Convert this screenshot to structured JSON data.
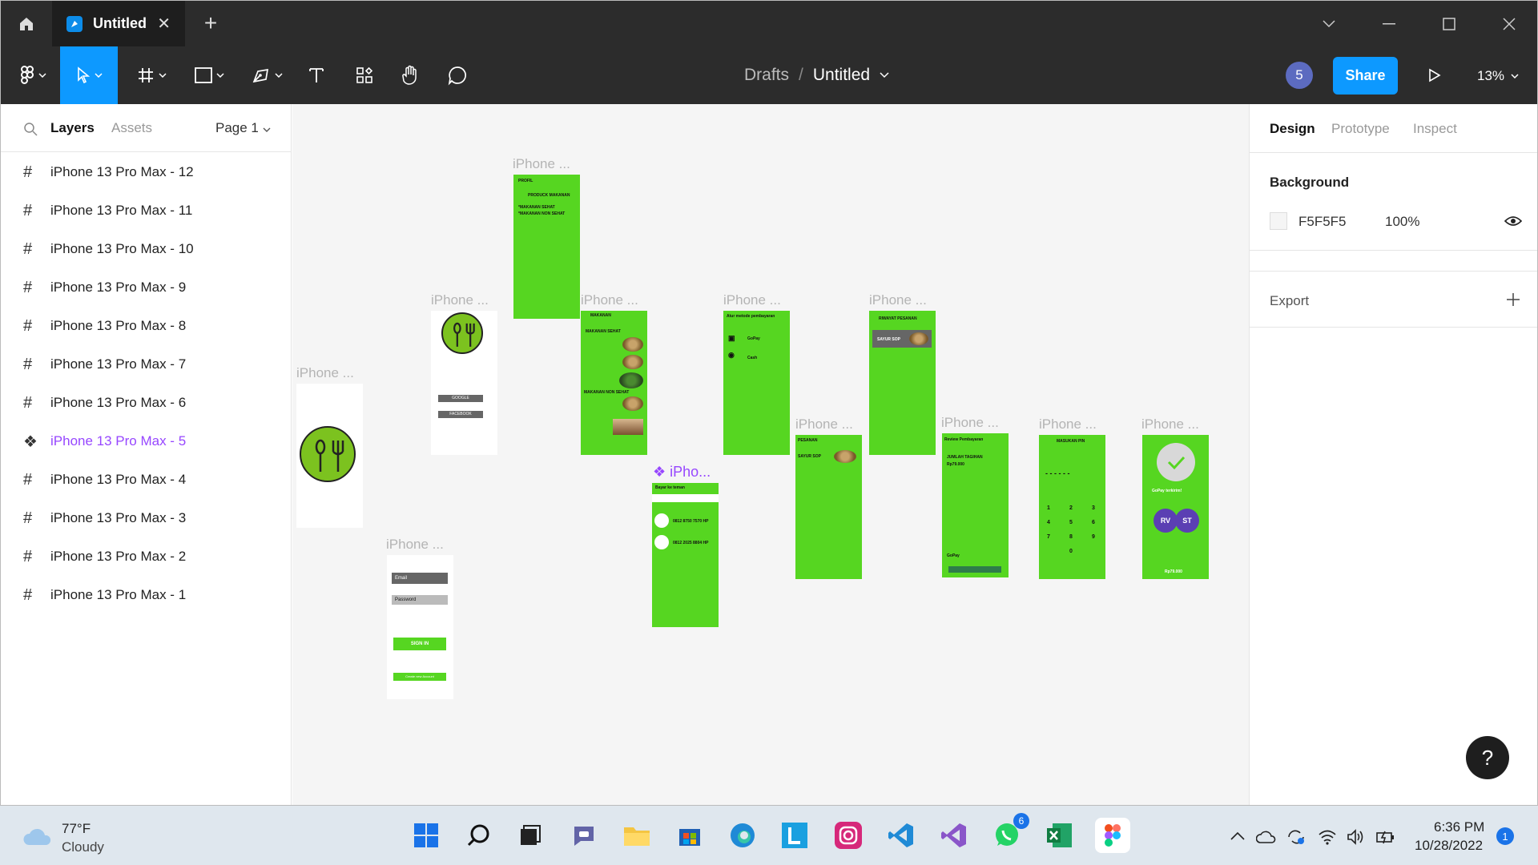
{
  "tab": {
    "title": "Untitled"
  },
  "breadcrumb": {
    "drafts": "Drafts",
    "sep": "/",
    "file": "Untitled"
  },
  "header": {
    "collab_count": "5",
    "share_label": "Share",
    "zoom": "13%"
  },
  "left_panel": {
    "tabs": {
      "layers": "Layers",
      "assets": "Assets"
    },
    "page": "Page 1",
    "layers": [
      {
        "name": "iPhone 13 Pro Max - 12",
        "type": "frame"
      },
      {
        "name": "iPhone 13 Pro Max - 11",
        "type": "frame"
      },
      {
        "name": "iPhone 13 Pro Max - 10",
        "type": "frame"
      },
      {
        "name": "iPhone 13 Pro Max - 9",
        "type": "frame"
      },
      {
        "name": "iPhone 13 Pro Max - 8",
        "type": "frame"
      },
      {
        "name": "iPhone 13 Pro Max - 7",
        "type": "frame"
      },
      {
        "name": "iPhone 13 Pro Max - 6",
        "type": "frame"
      },
      {
        "name": "iPhone 13 Pro Max - 5",
        "type": "component"
      },
      {
        "name": "iPhone 13 Pro Max - 4",
        "type": "frame"
      },
      {
        "name": "iPhone 13 Pro Max - 3",
        "type": "frame"
      },
      {
        "name": "iPhone 13 Pro Max - 2",
        "type": "frame"
      },
      {
        "name": "iPhone 13 Pro Max - 1",
        "type": "frame"
      }
    ]
  },
  "canvas": {
    "frame_label": "iPhone ...",
    "component_label": "iPho...",
    "screens": {
      "login_email": "Email",
      "login_password": "Password",
      "login_signin": "SIGN IN",
      "login_create": "Create new Account",
      "social_google": "GOOGLE",
      "social_facebook": "FACEBOOK",
      "profile_title": "PROFIL",
      "produk_title": "PRODUCK MAKANAN",
      "produk_line1": "*MAKANAN SEHAT",
      "produk_line2": "*MAKANAN NON SEHAT",
      "menu_heading": "MAKANAN",
      "menu_sehat": "MAKANAN SEHAT",
      "menu_nonsehat": "MAKANAN NON SEHAT",
      "pay_title": "Atur metode pembayaran",
      "pay_gopay": "GoPay",
      "pay_cash": "Cash",
      "pesanan_title": "PESANAN",
      "pesanan_item": "SAYUR SOP",
      "riwayat_title": "RIWAYAT PESANAN",
      "riwayat_item": "SAYUR SOP",
      "review_title": "Review Pembayaran",
      "review_sub": "JUMLAH TAGIHAN",
      "review_amount": "Rp79.000",
      "review_gopay": "GoPay",
      "pin_title": "MASUKAN PIN",
      "pin_dashes": "- - - - - -",
      "pin_keys": [
        "1",
        "2",
        "3",
        "4",
        "5",
        "6",
        "7",
        "8",
        "9",
        "0"
      ],
      "success_text": "GoPay terkirim!",
      "success_amount": "Rp79.000",
      "avatar_rv": "RV",
      "avatar_st": "ST",
      "bayar_title": "Bayar ke teman",
      "bayar_contact1": "0812 8750 7570 HP",
      "bayar_contact2": "0812 2025 8804 HP"
    }
  },
  "right_panel": {
    "tabs": {
      "design": "Design",
      "prototype": "Prototype",
      "inspect": "Inspect"
    },
    "background_label": "Background",
    "background_hex": "F5F5F5",
    "background_opacity": "100%",
    "export_label": "Export"
  },
  "help": "?",
  "taskbar": {
    "weather_temp": "77°F",
    "weather_desc": "Cloudy",
    "whatsapp_badge": "6",
    "time": "6:36 PM",
    "date": "10/28/2022",
    "notif_count": "1"
  },
  "colors": {
    "accent": "#0d99ff",
    "frame_green": "#56d621",
    "component_purple": "#9747ff",
    "toolbar_bg": "#2c2c2c",
    "canvas_bg": "#f5f5f5"
  }
}
